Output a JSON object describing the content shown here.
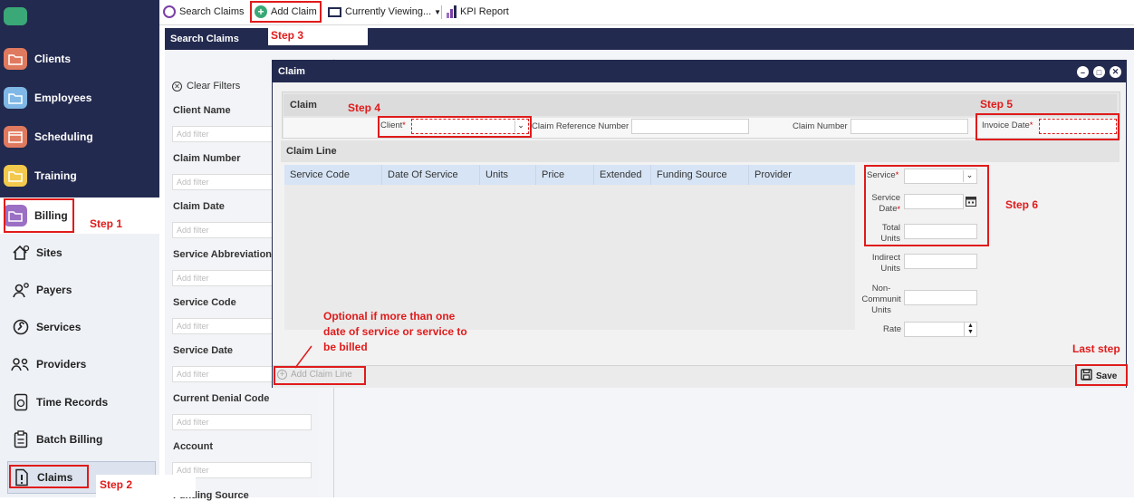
{
  "sidebar": {
    "items": [
      {
        "label": "Clients",
        "icon": "folder-icon",
        "color": "#e07a5f"
      },
      {
        "label": "Employees",
        "icon": "folder-icon",
        "color": "#7fb8e6"
      },
      {
        "label": "Scheduling",
        "icon": "calendar-icon",
        "color": "#e07a5f"
      },
      {
        "label": "Training",
        "icon": "folder-icon",
        "color": "#f2c94c"
      },
      {
        "label": "Billing",
        "icon": "folder-icon",
        "color": "#9b6fc4"
      }
    ],
    "sub_items": [
      {
        "label": "Sites",
        "icon": "house-gear-icon"
      },
      {
        "label": "Payers",
        "icon": "person-gear-icon"
      },
      {
        "label": "Services",
        "icon": "wrench-icon"
      },
      {
        "label": "Providers",
        "icon": "people-icon"
      },
      {
        "label": "Time Records",
        "icon": "clock-doc-icon"
      },
      {
        "label": "Batch Billing",
        "icon": "clipboard-icon"
      },
      {
        "label": "Claims",
        "icon": "alert-doc-icon"
      }
    ]
  },
  "toolbar": {
    "search_claims": "Search Claims",
    "add_claim": "Add Claim",
    "currently_viewing": "Currently Viewing...",
    "kpi_report": "KPI Report"
  },
  "panel": {
    "title": "Search Claims",
    "clear_filters": "Clear Filters",
    "filter_placeholder": "Add filter",
    "filters": [
      "Client Name",
      "Claim Number",
      "Claim Date",
      "Service Abbreviation",
      "Service Code",
      "Service Date",
      "Current Denial Code",
      "Account",
      "Funding Source"
    ]
  },
  "dialog": {
    "title": "Claim",
    "claim_section": "Claim",
    "client_label": "Client",
    "claim_ref_label": "Claim Reference Number",
    "claim_number_label": "Claim Number",
    "invoice_date_label": "Invoice Date",
    "claim_line_section": "Claim Line",
    "columns": [
      "Service Code",
      "Date Of Service",
      "Units",
      "Price",
      "Extended",
      "Funding Source",
      "Provider"
    ],
    "service_label": "Service",
    "service_date_label": "Service Date",
    "total_units_label": "Total Units",
    "indirect_units_label": "Indirect Units",
    "non_community_units_label": "Non-Communit Units",
    "rate_label": "Rate",
    "add_claim_line": "Add Claim Line",
    "save": "Save"
  },
  "annotations": {
    "step1": "Step 1",
    "step2": "Step 2",
    "step3": "Step 3",
    "step4": "Step 4",
    "step5": "Step 5",
    "step6": "Step 6",
    "last_step": "Last step",
    "optional_note": "Optional if more than one date of service or service to be billed"
  },
  "colors": {
    "navy": "#232a4f",
    "annotation_red": "#e01b1b",
    "required_red": "#d40000"
  }
}
